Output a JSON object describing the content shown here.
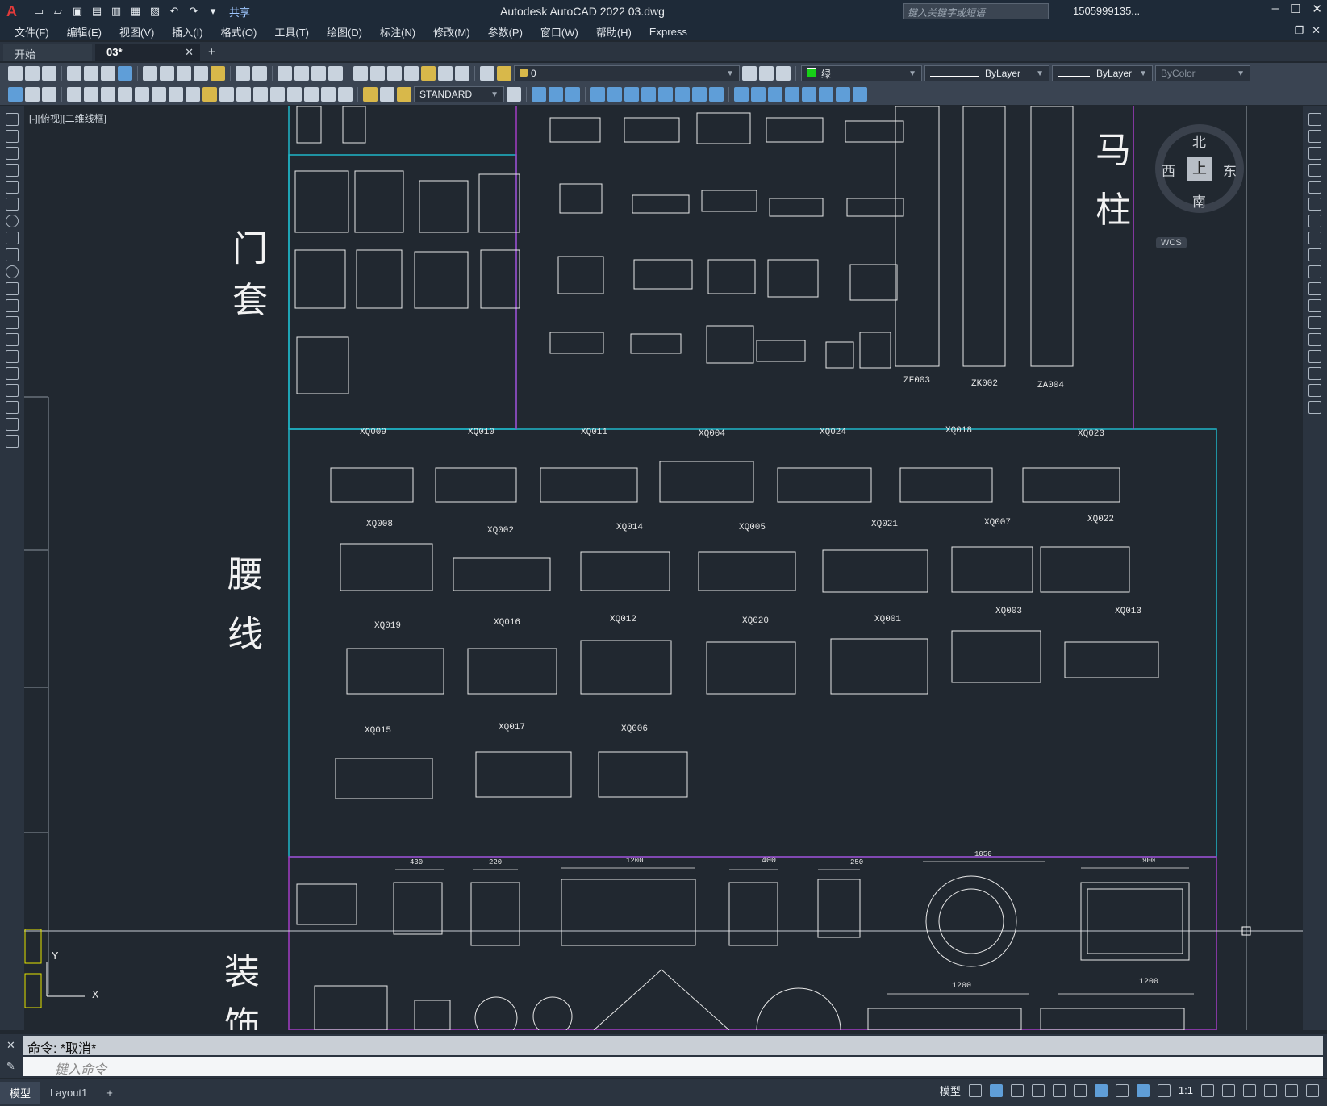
{
  "titlebar": {
    "app_logo": "A",
    "share_label": "共享",
    "window_title": "Autodesk AutoCAD 2022    03.dwg",
    "search_placeholder": "键入关键字或短语",
    "user_name": "1505999135...",
    "window_controls": [
      "–",
      "☐",
      "✕"
    ]
  },
  "menu": {
    "items": [
      "文件(F)",
      "编辑(E)",
      "视图(V)",
      "插入(I)",
      "格式(O)",
      "工具(T)",
      "绘图(D)",
      "标注(N)",
      "修改(M)",
      "参数(P)",
      "窗口(W)",
      "帮助(H)",
      "Express"
    ],
    "mdi_controls": [
      "–",
      "❐",
      "✕"
    ]
  },
  "file_tabs": {
    "tabs": [
      "开始",
      "03*"
    ],
    "close": "✕",
    "new_tab": "+"
  },
  "toolbar": {
    "layer_value": "0",
    "color_value": "绿",
    "color_hex": "#17d017",
    "linetype_value": "ByLayer",
    "lineweight_value": "ByLayer",
    "plotstyle_value": "ByColor",
    "textstyle_value": "STANDARD"
  },
  "viewport": {
    "label": "[-][俯视][二维线框]",
    "compass": {
      "north": "北",
      "south": "南",
      "east": "东",
      "west": "西",
      "top": "上"
    },
    "wcs": "WCS",
    "axis_y": "Y",
    "axis_x": "X"
  },
  "drawing": {
    "sections": [
      "门",
      "套",
      "腰",
      "线",
      "装",
      "饰",
      "马",
      "柱"
    ],
    "column_labels": [
      "ZF003",
      "ZK002",
      "ZA004"
    ],
    "molding_labels": [
      "XQ009",
      "XQ010",
      "XQ011",
      "XQ004",
      "XQ024",
      "XQ018",
      "XQ023",
      "XQ008",
      "XQ002",
      "XQ014",
      "XQ005",
      "XQ021",
      "XQ007",
      "XQ022",
      "XQ019",
      "XQ016",
      "XQ012",
      "XQ020",
      "XQ001",
      "XQ003",
      "XQ013",
      "XQ015",
      "XQ017",
      "XQ006"
    ],
    "dims": [
      "430",
      "220",
      "1200",
      "400",
      "250",
      "1050",
      "900",
      "1200",
      "1200"
    ],
    "frame_colors": {
      "cyan": "#1fb6c8",
      "magenta": "#a23cc4"
    }
  },
  "command": {
    "history": "命令: *取消*",
    "placeholder": "键入命令"
  },
  "status": {
    "layout_tabs": [
      "模型",
      "Layout1",
      "+"
    ],
    "model_label": "模型",
    "scale": "1:1"
  }
}
